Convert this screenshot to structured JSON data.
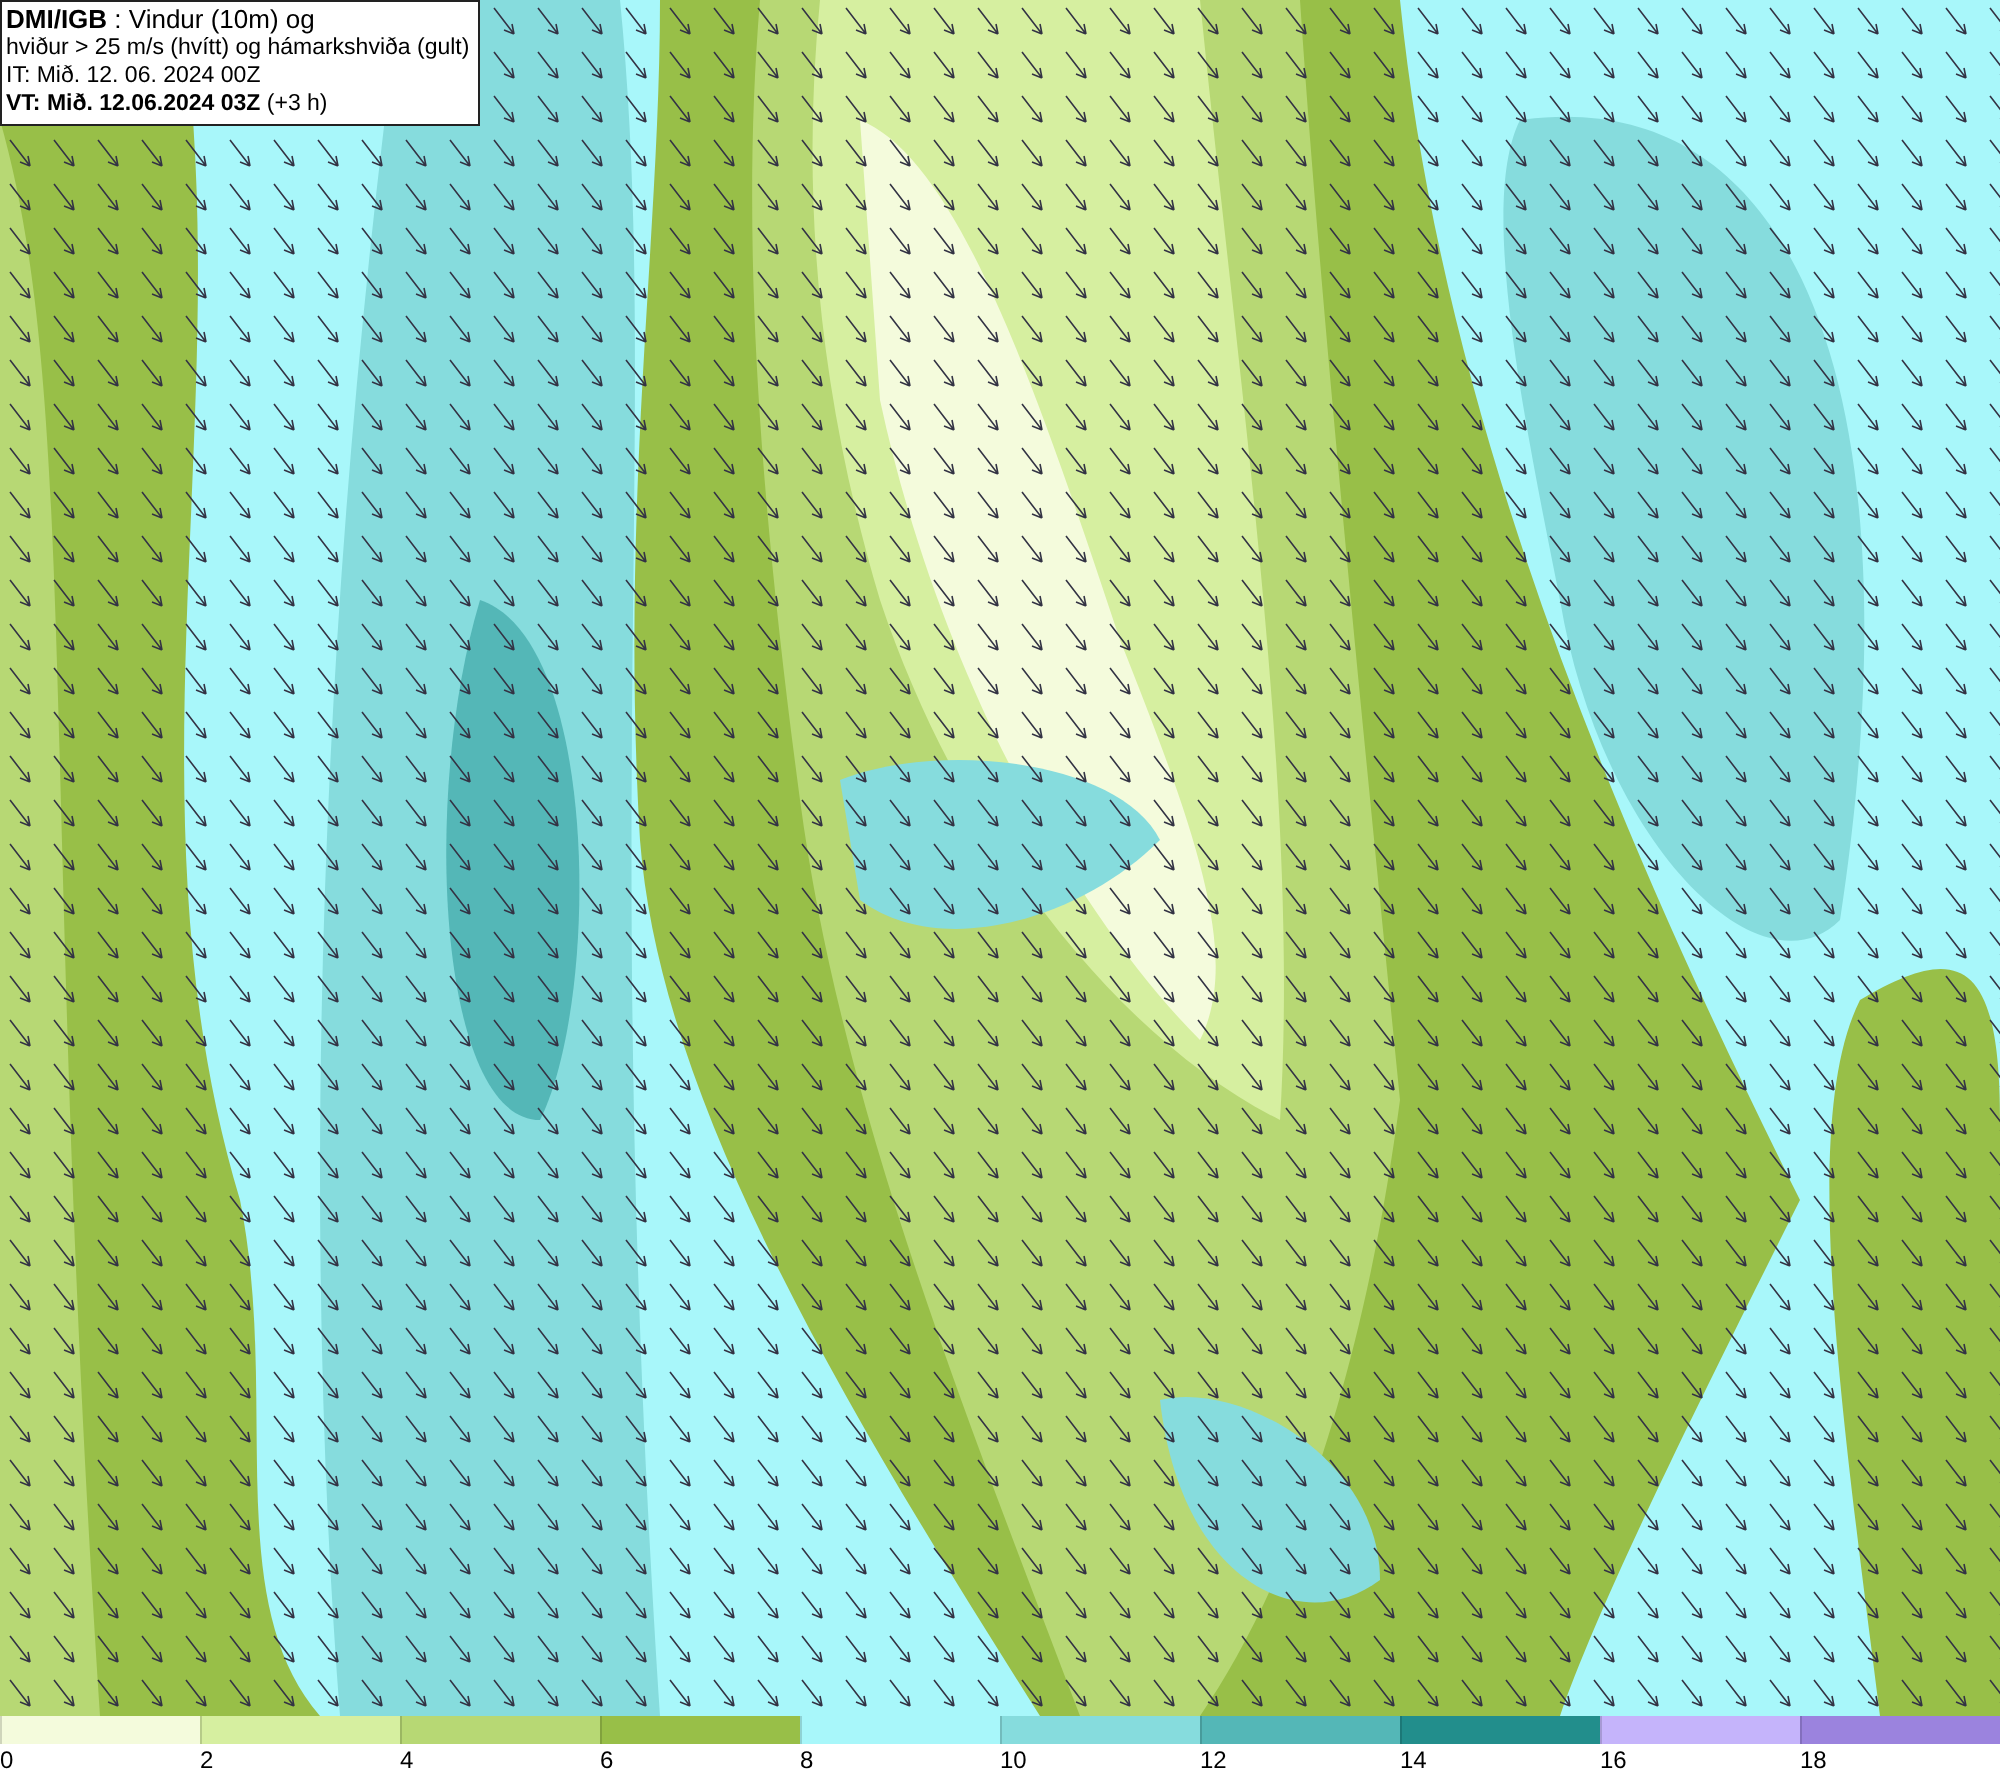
{
  "info_box": {
    "lines": [
      "**DMI/IGB** : Vindur (10m) og",
      "hviður > 25 m/s (hvítt) og hámarkshviða (gult)",
      "IT: Mið. 12. 06. 2024 00Z",
      "**VT: Mið. 12.06.2024 03Z** (+3 h)"
    ]
  },
  "legend": [
    {
      "label": "0",
      "color": "#f4fbdc"
    },
    {
      "label": "2",
      "color": "#d6efa0"
    },
    {
      "label": "4",
      "color": "#b7d874"
    },
    {
      "label": "6",
      "color": "#98bf48"
    },
    {
      "label": "8",
      "color": "#a8f7fa"
    },
    {
      "label": "10",
      "color": "#86dcdd"
    },
    {
      "label": "12",
      "color": "#54b7b7"
    },
    {
      "label": "14",
      "color": "#228e8c"
    },
    {
      "label": "16",
      "color": "#c5b4fb"
    },
    {
      "label": "18",
      "color": "#9b83de"
    }
  ]
}
